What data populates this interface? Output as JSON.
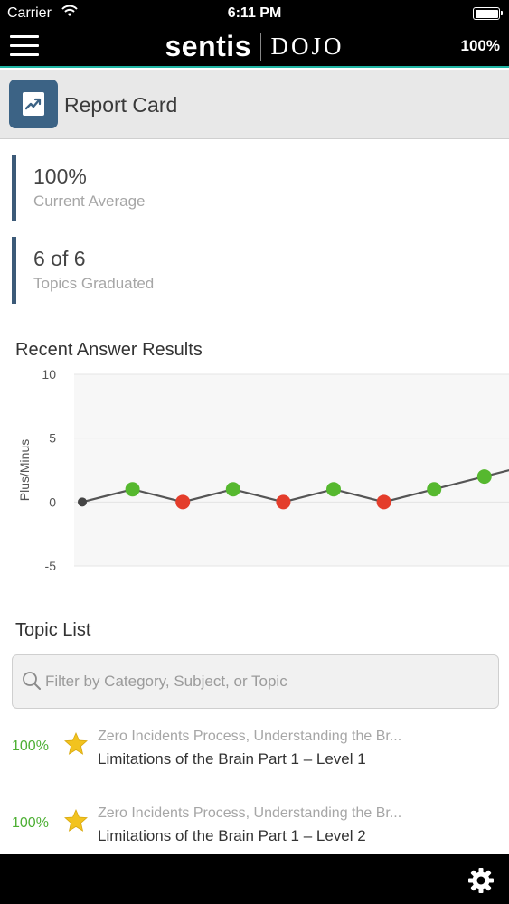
{
  "status_bar": {
    "carrier": "Carrier",
    "time": "6:11 PM"
  },
  "header": {
    "brand_main": "sentis",
    "brand_sub": "DOJO",
    "percentage": "100%"
  },
  "page": {
    "title": "Report Card"
  },
  "stats": [
    {
      "value": "100%",
      "label": "Current Average"
    },
    {
      "value": "6 of 6",
      "label": "Topics Graduated"
    }
  ],
  "chart_section": {
    "title": "Recent Answer Results"
  },
  "chart_data": {
    "type": "line",
    "title": "Recent Answer Results",
    "xlabel": "",
    "ylabel": "Plus/Minus",
    "ylim": [
      -5,
      10
    ],
    "yticks": [
      "10",
      "5",
      "0",
      "-5"
    ],
    "grid": true,
    "series": [
      {
        "values": [
          0,
          1,
          0,
          1,
          0,
          1,
          0,
          1,
          2,
          3
        ],
        "point_colors": [
          "#444444",
          "#56b82f",
          "#e43d2b",
          "#56b82f",
          "#e43d2b",
          "#56b82f",
          "#e43d2b",
          "#56b82f",
          "#56b82f",
          "#56b82f"
        ]
      }
    ]
  },
  "topic_section": {
    "title": "Topic List"
  },
  "search": {
    "placeholder": "Filter by Category, Subject, or Topic",
    "value": ""
  },
  "topics": [
    {
      "percent": "100%",
      "category": "Zero Incidents Process, Understanding the Br...",
      "name": "Limitations of the Brain Part 1 – Level 1"
    },
    {
      "percent": "100%",
      "category": "Zero Incidents Process, Understanding the Br...",
      "name": "Limitations of the Brain Part 1 – Level 2"
    }
  ],
  "colors": {
    "accent": "#1fb5a4",
    "stat_border": "#3c5a78",
    "icon_bg": "#3c6385",
    "success": "#56b82f",
    "error": "#e43d2b",
    "star": "#f2c31f"
  },
  "icons": {
    "menu": "hamburger-menu-icon",
    "wifi": "wifi-icon",
    "battery": "battery-icon",
    "report": "report-chart-icon",
    "search": "search-icon",
    "star": "star-icon",
    "settings": "gear-icon"
  }
}
